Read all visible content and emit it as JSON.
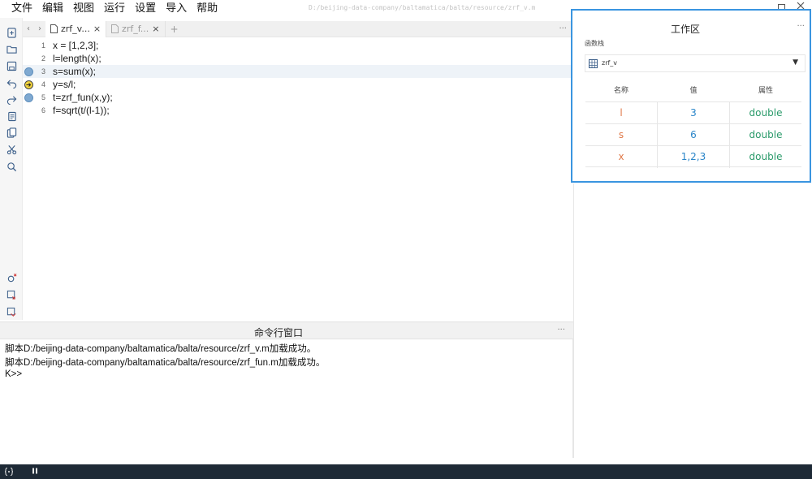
{
  "menu": [
    "文件",
    "编辑",
    "视图",
    "运行",
    "设置",
    "导入",
    "帮助"
  ],
  "window": {
    "path": "D:/beijing-data-company/baltamatica/balta/resource/zrf_v.m"
  },
  "tabs": {
    "active": {
      "label": "zrf_v...",
      "close": "×"
    },
    "inactive": {
      "label": "zrf_f...",
      "close": "×"
    },
    "add": "+",
    "prev": "‹",
    "next": "›",
    "more": "···"
  },
  "editor": {
    "lines": [
      {
        "num": "1",
        "code": "x = [1,2,3];"
      },
      {
        "num": "2",
        "code": "l=length(x);"
      },
      {
        "num": "3",
        "code": "s=sum(x);"
      },
      {
        "num": "4",
        "code": "y=s/l;"
      },
      {
        "num": "5",
        "code": "t=zrf_fun(x,y);"
      },
      {
        "num": "6",
        "code": "f=sqrt(t/(l-1));"
      }
    ],
    "current_line": 3,
    "breakpoints": [
      3,
      5
    ],
    "exec_line": 4
  },
  "command_window": {
    "title": "命令行窗口",
    "more": "···",
    "lines": [
      "脚本D:/beijing-data-company/baltamatica/balta/resource/zrf_v.m加载成功。",
      "脚本D:/beijing-data-company/baltamatica/balta/resource/zrf_fun.m加载成功。",
      "K>>"
    ]
  },
  "workspace": {
    "title": "工作区",
    "more": "···",
    "stack_label": "函数栈",
    "stack_value": "zrf_v",
    "columns": [
      "名称",
      "值",
      "属性"
    ],
    "rows": [
      {
        "name": "l",
        "value": "3",
        "attr": "double"
      },
      {
        "name": "s",
        "value": "6",
        "attr": "double"
      },
      {
        "name": "x",
        "value": "1,2,3",
        "attr": "double"
      }
    ]
  },
  "colors": {
    "accent": "#3a95e0",
    "name": "#e07a4a",
    "value": "#2b86c9",
    "attr": "#2a9a6a",
    "statusbar": "#1e2a36"
  }
}
